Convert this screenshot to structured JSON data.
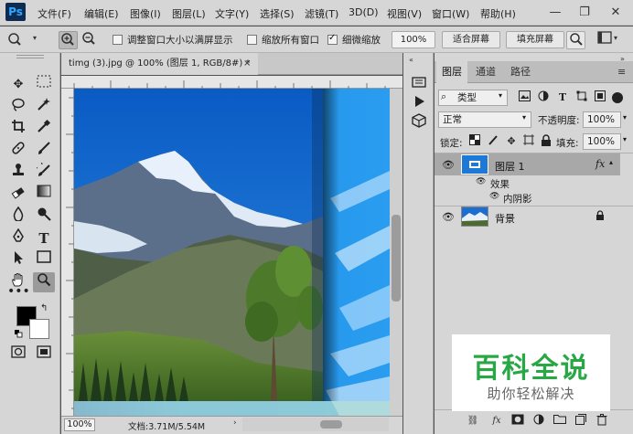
{
  "app": {
    "logo": "Ps"
  },
  "menu": [
    "文件(F)",
    "编辑(E)",
    "图像(I)",
    "图层(L)",
    "文字(Y)",
    "选择(S)",
    "滤镜(T)",
    "3D(D)",
    "视图(V)",
    "窗口(W)",
    "帮助(H)"
  ],
  "window_controls": {
    "minimize": "—",
    "restore": "❐",
    "close": "✕"
  },
  "options": {
    "resize_windows_label": "调整窗口大小以满屏显示",
    "zoom_all_label": "缩放所有窗口",
    "scrubby_zoom_label": "细微缩放",
    "zoom_value": "100%",
    "fit_screen": "适合屏幕",
    "fill_screen": "填充屏幕"
  },
  "document": {
    "tab_title": "timg (3).jpg @ 100% (图层 1, RGB/8#) *",
    "close": "×",
    "status_zoom": "100%",
    "status_info": "文档:3.71M/5.54M"
  },
  "layers_panel": {
    "tabs": [
      "图层",
      "通道",
      "路径"
    ],
    "active_tab": 0,
    "filter_kind": "类型",
    "blend_mode": "正常",
    "opacity_label": "不透明度:",
    "opacity_value": "100%",
    "lock_label": "锁定:",
    "fill_label": "填充:",
    "fill_value": "100%",
    "layers": [
      {
        "name": "图层 1",
        "fx": "fx",
        "selected": true
      },
      {
        "name": "背景",
        "locked": true
      }
    ],
    "effects_label": "效果",
    "inner_shadow_label": "内阴影"
  },
  "watermark": {
    "title": "百科全说",
    "subtitle": "助你轻松解决"
  },
  "colors": {
    "accent": "#31a8ff",
    "watermark_green": "#28a745"
  }
}
